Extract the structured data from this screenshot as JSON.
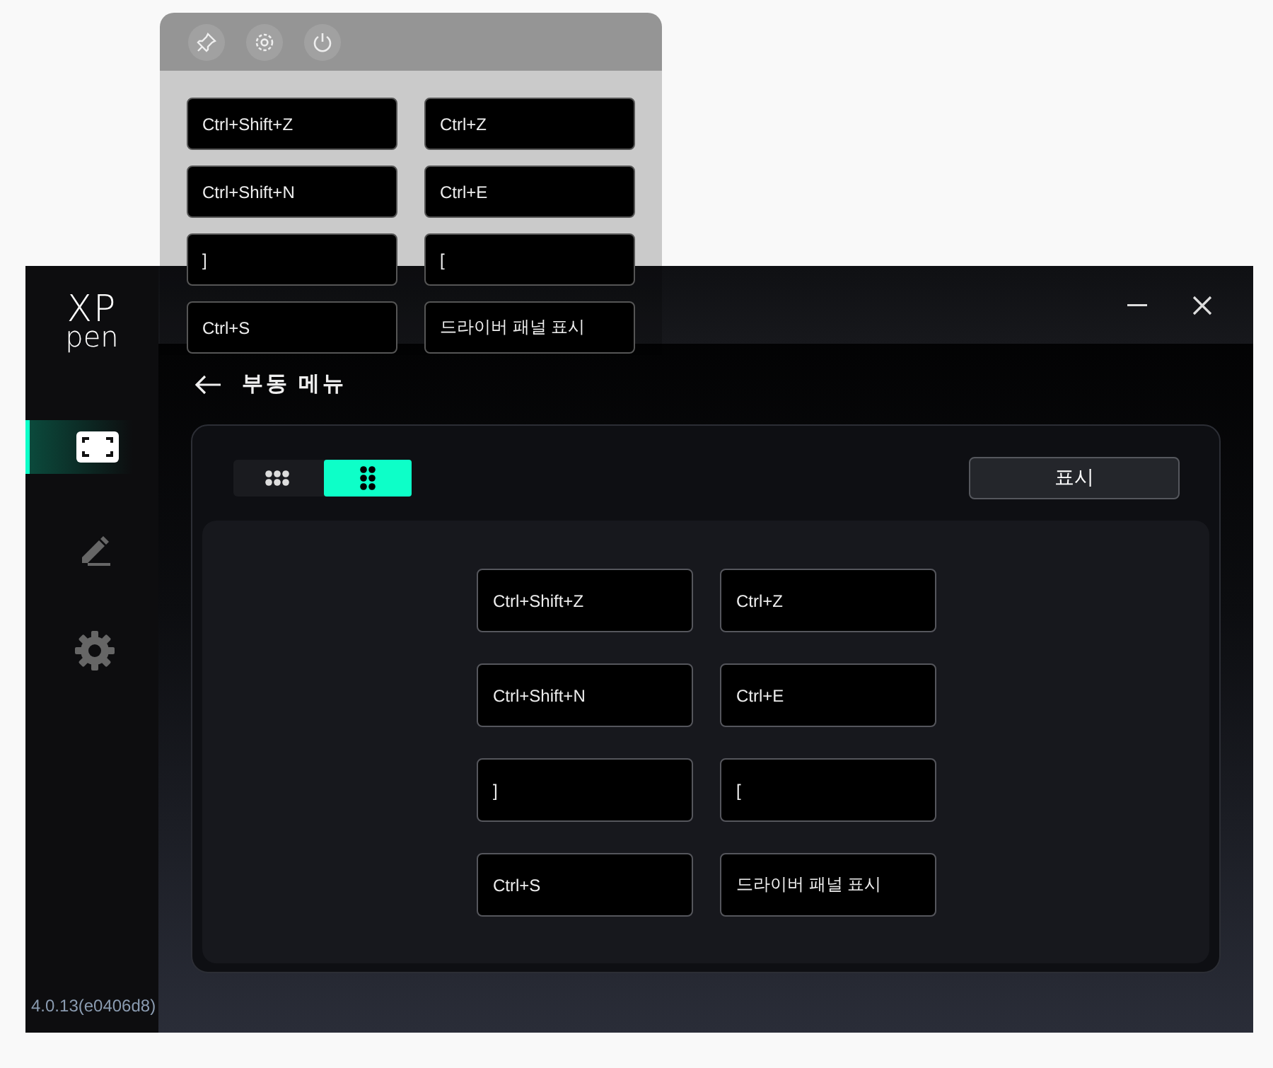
{
  "floating_panel": {
    "keys": [
      "Ctrl+Shift+Z",
      "Ctrl+Z",
      "Ctrl+Shift+N",
      "Ctrl+E",
      "]",
      "[",
      "Ctrl+S",
      "드라이버 패널 표시"
    ]
  },
  "window": {
    "logo": {
      "top": "XP",
      "bottom": "pen"
    }
  },
  "sidebar": {
    "items": [
      {
        "kind": "display",
        "selected": true
      },
      {
        "kind": "pen",
        "selected": false
      },
      {
        "kind": "settings",
        "selected": false
      }
    ],
    "version": "4.0.13(e0406d8)"
  },
  "page": {
    "title": "부동 메뉴",
    "layout_options": [
      {
        "kind": "wide",
        "selected": false
      },
      {
        "kind": "tall",
        "selected": true
      }
    ],
    "show_button": "표시",
    "keys": [
      "Ctrl+Shift+Z",
      "Ctrl+Z",
      "Ctrl+Shift+N",
      "Ctrl+E",
      "]",
      "[",
      "Ctrl+S",
      "드라이버 패널 표시"
    ]
  }
}
